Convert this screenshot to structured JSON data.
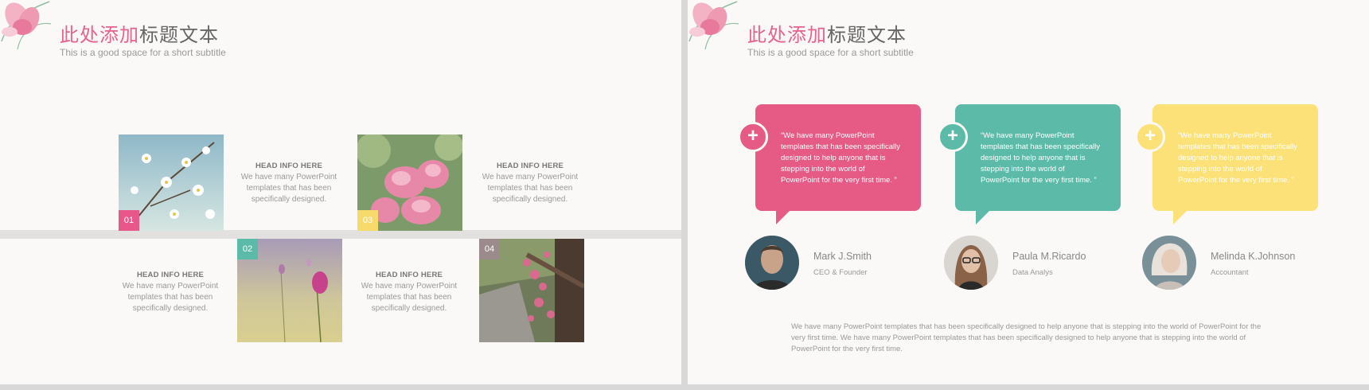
{
  "slides": [
    {
      "title_accent": "此处添加",
      "title_rest": "标题文本",
      "subtitle": "This is a good space  for a short subtitle",
      "items": [
        {
          "number": "01",
          "head": "HEAD INFO HERE",
          "body": "We have many PowerPoint templates that has been specifically designed."
        },
        {
          "number": "02",
          "head": "HEAD INFO HERE",
          "body": "We have many PowerPoint templates that has been specifically designed."
        },
        {
          "number": "03",
          "head": "HEAD INFO HERE",
          "body": "We have many PowerPoint templates that has been specifically designed."
        },
        {
          "number": "04",
          "head": "HEAD INFO HERE",
          "body": "We have many PowerPoint templates that has been specifically designed."
        }
      ]
    },
    {
      "title_accent": "此处添加",
      "title_rest": "标题文本",
      "subtitle": "This is a good space  for a short subtitle",
      "testimonials": [
        {
          "quote": "“We have many PowerPoint templates that has been specifically designed to help anyone that is stepping into the world of PowerPoint for the very first time. ”",
          "name": "Mark J.Smith",
          "role": "CEO & Founder",
          "color": "#e65a86",
          "plus": "+"
        },
        {
          "quote": "“We have many PowerPoint templates that has been specifically designed to help anyone that is stepping into the world of PowerPoint for the very first time. ”",
          "name": "Paula M.Ricardo",
          "role": "Data Analys",
          "color": "#5bbba8",
          "plus": "+"
        },
        {
          "quote": "“We have many PowerPoint templates that has been specifically designed to help anyone that is stepping into the world of PowerPoint for the very first time. ”",
          "name": "Melinda K.Johnson",
          "role": "Accountant",
          "color": "#fbe178",
          "plus": "+"
        }
      ],
      "footer": "We have many PowerPoint templates that has been specifically designed to help anyone that is stepping into the world of PowerPoint for the very first time. We have many PowerPoint templates that has been specifically designed to help anyone that is stepping into the world of PowerPoint for the very first time."
    }
  ],
  "colors": {
    "pink": "#e65a86",
    "teal": "#5bbba8",
    "yellow": "#fbe178",
    "mauve": "#9c8b8d",
    "background": "#fbf9f7"
  },
  "icons": [
    "flower-decoration-icon",
    "plus-icon"
  ]
}
